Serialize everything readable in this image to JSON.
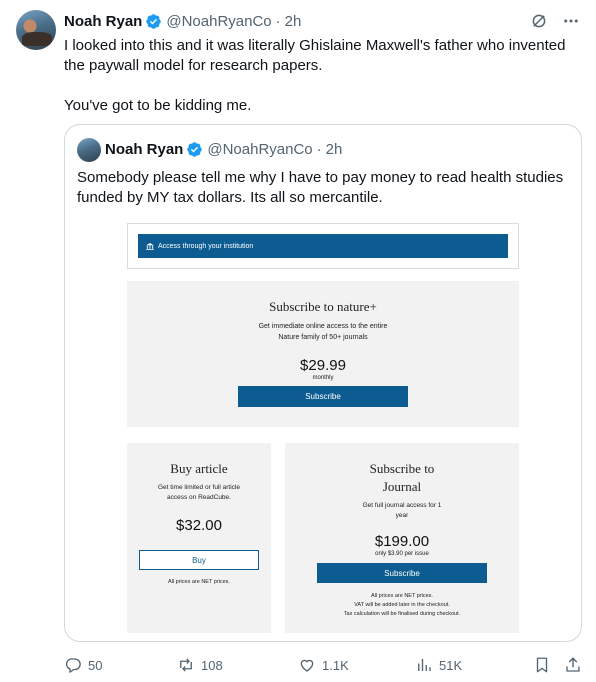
{
  "tweet": {
    "author_name": "Noah Ryan",
    "author_handle": "@NoahRyanCo",
    "separator": "·",
    "time": "2h",
    "text_line1": "I looked into this and it was literally Ghislaine Maxwell's father who invented the paywall model for research papers.",
    "text_line2": "You've got to be kidding me."
  },
  "quoted": {
    "author_name": "Noah Ryan",
    "author_handle": "@NoahRyanCo",
    "separator": "·",
    "time": "2h",
    "text": "Somebody please tell me why I have to pay money to read health studies funded by MY tax dollars. Its all so mercantile."
  },
  "embedded_image": {
    "institution_button": "Access through your institution",
    "nature_plus": {
      "title": "Subscribe to nature+",
      "desc_line1": "Get immediate online access to the entire",
      "desc_line2": "Nature family of 50+ journals",
      "price": "$29.99",
      "period": "monthly",
      "button": "Subscribe"
    },
    "buy_article": {
      "title": "Buy article",
      "desc_line1": "Get time limited or full article",
      "desc_line2": "access on ReadCube.",
      "price": "$32.00",
      "button": "Buy",
      "note": "All prices are NET prices."
    },
    "journal": {
      "title_line1": "Subscribe to",
      "title_line2": "Journal",
      "desc_line1": "Get full journal access for 1",
      "desc_line2": "year",
      "price": "$199.00",
      "per_issue": "only $3.90 per issue",
      "button": "Subscribe",
      "note_line1": "All prices are NET prices.",
      "note_line2": "VAT will be added later in the checkout.",
      "note_line3": "Tax calculation will be finalised during checkout."
    }
  },
  "actions": {
    "replies": "50",
    "reposts": "108",
    "likes": "1.1K",
    "views": "51K"
  },
  "icons": {
    "verified": "verified-badge-icon",
    "grok": "grok-icon",
    "more": "more-icon",
    "reply": "reply-icon",
    "repost": "repost-icon",
    "like": "like-icon",
    "views": "views-icon",
    "bookmark": "bookmark-icon",
    "share": "share-icon"
  },
  "colors": {
    "verified": "#1d9bf0",
    "text": "#0f1419",
    "secondary": "#536471",
    "nature_blue": "#0d5c91"
  }
}
